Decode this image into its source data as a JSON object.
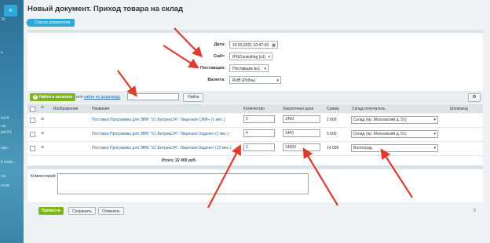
{
  "left_strip": {
    "texts": [
      "24",
      "ь",
      "ks24",
      "ьм",
      "ркс24",
      "при...",
      "й разр...",
      "сы",
      "етам"
    ]
  },
  "window": {
    "close_label": "×",
    "title": "Новый документ. Приход товара на склад"
  },
  "docs_button": "Список документов",
  "form": {
    "date_label": "Дата:",
    "date_value": "10.03.2021 10:47:43",
    "site_label": "Сайт:",
    "site_value": "IPGConsulting (s1)",
    "supplier_label": "Поставщик:",
    "supplier_value": "Поставщик №1",
    "currency_label": "Валюта:",
    "currency_value": "RUB (Рубль)"
  },
  "toolbar": {
    "add_label": "Найти в каталоге",
    "or_text": "или",
    "barcode_link": "найти по штрихкоду",
    "search_value": "",
    "find_label": "Найти",
    "settings_icon": "gear-icon"
  },
  "table": {
    "headers": [
      "Изображение",
      "Название",
      "Количество",
      "Закупочная цена",
      "Сумма",
      "Склад-получатель",
      "Штрихкод"
    ],
    "rows": [
      {
        "name": "Поставка Программы для ЭВМ \"1С-Битрикс24\". Лицензия CRM+ (1 мес.)",
        "qty": "2",
        "price": "1400",
        "sum": "2 800",
        "warehouse": "Склад (пр. Московский д. 51)"
      },
      {
        "name": "Поставка Программы для ЭВМ \"1С-Битрикс24\". Лицензия Задачи+ (1 мес.)",
        "qty": "4",
        "price": "1400",
        "sum": "5 600",
        "warehouse": "Склад (пр. Московский д. 51)"
      },
      {
        "name": "Поставка Программы для ЭВМ \"1С-Битрикс24\". Лицензия Задачи+ (12 мес.)",
        "qty": "1",
        "price": "14000",
        "sum": "14 000",
        "warehouse": "Волгоград"
      }
    ],
    "total": "Итого: 22 400 руб."
  },
  "comment_label": "Комментарий:",
  "footer": {
    "post": "Провести",
    "save": "Сохранить",
    "cancel": "Отменить"
  },
  "colors": {
    "accent_blue": "#2fa8d9",
    "green": "#7cb518",
    "arrow_red": "#e03a2c"
  }
}
